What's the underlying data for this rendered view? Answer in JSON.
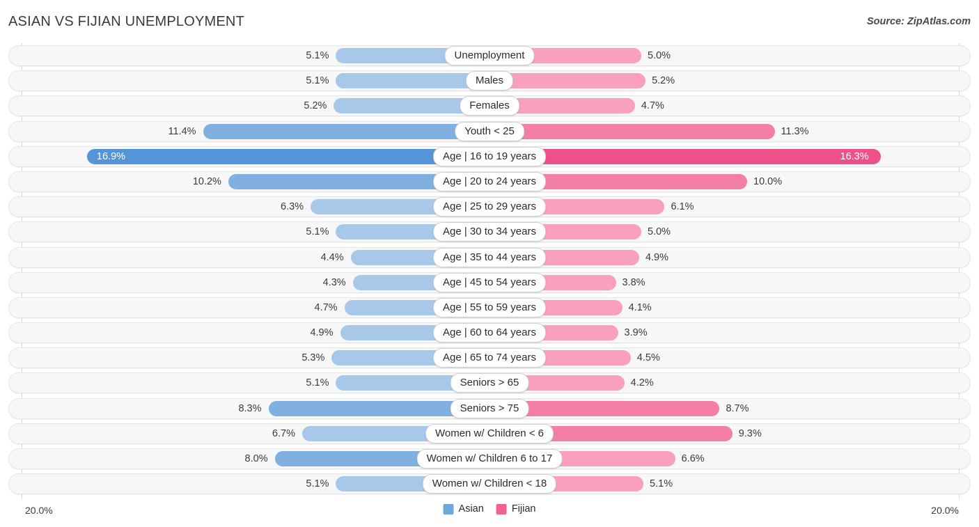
{
  "header": {
    "title": "ASIAN VS FIJIAN UNEMPLOYMENT",
    "source": "Source: ZipAtlas.com"
  },
  "footer": {
    "axis_max_left": "20.0%",
    "axis_max_right": "20.0%"
  },
  "legend": {
    "items": [
      {
        "label": "Asian",
        "color": "#6fa8dc"
      },
      {
        "label": "Fijian",
        "color": "#f2628f"
      }
    ]
  },
  "colors": {
    "asian_light": "#a8c8ea",
    "asian_mid": "#7fb0e0",
    "asian_dark": "#5494d8",
    "fijian_light": "#f8a0bd",
    "fijian_mid": "#f47fa5",
    "fijian_dark": "#ee5189",
    "track_bg": "#f7f7f7",
    "track_border": "#e6e6e6",
    "axis": "#d8d8d8"
  },
  "chart_data": {
    "type": "bar",
    "orientation": "horizontal-diverging",
    "title": "ASIAN VS FIJIAN UNEMPLOYMENT",
    "xlabel": "",
    "ylabel": "",
    "xlim": [
      0,
      20.0
    ],
    "units": "%",
    "grid": false,
    "legend_position": "bottom-center",
    "categories": [
      "Unemployment",
      "Males",
      "Females",
      "Youth < 25",
      "Age | 16 to 19 years",
      "Age | 20 to 24 years",
      "Age | 25 to 29 years",
      "Age | 30 to 34 years",
      "Age | 35 to 44 years",
      "Age | 45 to 54 years",
      "Age | 55 to 59 years",
      "Age | 60 to 64 years",
      "Age | 65 to 74 years",
      "Seniors > 65",
      "Seniors > 75",
      "Women w/ Children < 6",
      "Women w/ Children 6 to 17",
      "Women w/ Children < 18"
    ],
    "series": [
      {
        "name": "Asian",
        "side": "left",
        "color": "#6fa8dc",
        "values": [
          5.1,
          5.1,
          5.2,
          11.4,
          16.9,
          10.2,
          6.3,
          5.1,
          4.4,
          4.3,
          4.7,
          4.9,
          5.3,
          5.1,
          8.3,
          6.7,
          8.0,
          5.1
        ],
        "labels": [
          "5.1%",
          "5.1%",
          "5.2%",
          "11.4%",
          "16.9%",
          "10.2%",
          "6.3%",
          "5.1%",
          "4.4%",
          "4.3%",
          "4.7%",
          "4.9%",
          "5.3%",
          "5.1%",
          "8.3%",
          "6.7%",
          "8.0%",
          "5.1%"
        ]
      },
      {
        "name": "Fijian",
        "side": "right",
        "color": "#f2628f",
        "values": [
          5.0,
          5.2,
          4.7,
          11.3,
          16.3,
          10.0,
          6.1,
          5.0,
          4.9,
          3.8,
          4.1,
          3.9,
          4.5,
          4.2,
          8.7,
          9.3,
          6.6,
          5.1
        ],
        "labels": [
          "5.0%",
          "5.2%",
          "4.7%",
          "11.3%",
          "16.3%",
          "10.0%",
          "6.1%",
          "5.0%",
          "4.9%",
          "3.8%",
          "4.1%",
          "3.9%",
          "4.5%",
          "4.2%",
          "8.7%",
          "9.3%",
          "6.6%",
          "5.1%"
        ]
      }
    ]
  },
  "rows": [
    {
      "label": "Unemployment",
      "left_label": "5.1%",
      "right_label": "5.0%",
      "left_value": 5.1,
      "right_value": 5.0
    },
    {
      "label": "Males",
      "left_label": "5.1%",
      "right_label": "5.2%",
      "left_value": 5.1,
      "right_value": 5.2
    },
    {
      "label": "Females",
      "left_label": "5.2%",
      "right_label": "4.7%",
      "left_value": 5.2,
      "right_value": 4.7
    },
    {
      "label": "Youth < 25",
      "left_label": "11.4%",
      "right_label": "11.3%",
      "left_value": 11.4,
      "right_value": 11.3
    },
    {
      "label": "Age | 16 to 19 years",
      "left_label": "16.9%",
      "right_label": "16.3%",
      "left_value": 16.9,
      "right_value": 16.3
    },
    {
      "label": "Age | 20 to 24 years",
      "left_label": "10.2%",
      "right_label": "10.0%",
      "left_value": 10.2,
      "right_value": 10.0
    },
    {
      "label": "Age | 25 to 29 years",
      "left_label": "6.3%",
      "right_label": "6.1%",
      "left_value": 6.3,
      "right_value": 6.1
    },
    {
      "label": "Age | 30 to 34 years",
      "left_label": "5.1%",
      "right_label": "5.0%",
      "left_value": 5.1,
      "right_value": 5.0
    },
    {
      "label": "Age | 35 to 44 years",
      "left_label": "4.4%",
      "right_label": "4.9%",
      "left_value": 4.4,
      "right_value": 4.9
    },
    {
      "label": "Age | 45 to 54 years",
      "left_label": "4.3%",
      "right_label": "3.8%",
      "left_value": 4.3,
      "right_value": 3.8
    },
    {
      "label": "Age | 55 to 59 years",
      "left_label": "4.7%",
      "right_label": "4.1%",
      "left_value": 4.7,
      "right_value": 4.1
    },
    {
      "label": "Age | 60 to 64 years",
      "left_label": "4.9%",
      "right_label": "3.9%",
      "left_value": 4.9,
      "right_value": 3.9
    },
    {
      "label": "Age | 65 to 74 years",
      "left_label": "5.3%",
      "right_label": "4.5%",
      "left_value": 5.3,
      "right_value": 4.5
    },
    {
      "label": "Seniors > 65",
      "left_label": "5.1%",
      "right_label": "4.2%",
      "left_value": 5.1,
      "right_value": 4.2
    },
    {
      "label": "Seniors > 75",
      "left_label": "8.3%",
      "right_label": "8.7%",
      "left_value": 8.3,
      "right_value": 8.7
    },
    {
      "label": "Women w/ Children < 6",
      "left_label": "6.7%",
      "right_label": "9.3%",
      "left_value": 6.7,
      "right_value": 9.3
    },
    {
      "label": "Women w/ Children 6 to 17",
      "left_label": "8.0%",
      "right_label": "6.6%",
      "left_value": 8.0,
      "right_value": 6.6
    },
    {
      "label": "Women w/ Children < 18",
      "left_label": "5.1%",
      "right_label": "5.1%",
      "left_value": 5.1,
      "right_value": 5.1
    }
  ]
}
